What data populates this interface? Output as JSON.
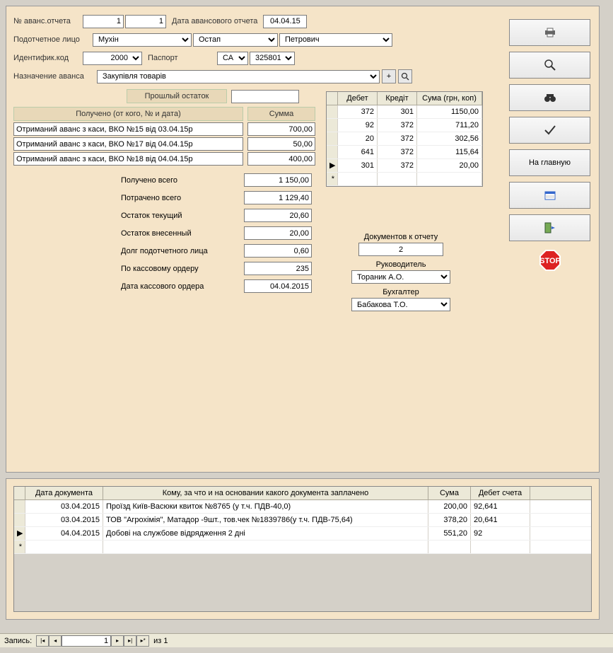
{
  "header": {
    "report_no_label": "№ аванс.отчета",
    "report_no1": "1",
    "report_no2": "1",
    "report_date_label": "Дата авансового отчета",
    "report_date": "04.04.15",
    "person_label": "Подотчетное лицо",
    "lastname": "Мухін",
    "firstname": "Остап",
    "patronymic": "Петрович",
    "id_label": "Идентифик.код",
    "id_code": "2000",
    "passport_label": "Паспорт",
    "passport_series": "СА",
    "passport_no": "325801",
    "purpose_label": "Назначение аванса",
    "purpose": "Закупівля товарів",
    "prev_balance_label": "Прошлый остаток",
    "prev_balance": ""
  },
  "received": {
    "header_who": "Получено (от кого, № и дата)",
    "header_sum": "Сумма",
    "rows": [
      {
        "desc": "Отриманий аванс з каси, ВКО №15 від 03.04.15р",
        "sum": "700,00"
      },
      {
        "desc": "Отриманий аванс з каси, ВКО №17 від 04.04.15р",
        "sum": "50,00"
      },
      {
        "desc": "Отриманий аванс з каси, ВКО №18 від 04.04.15р",
        "sum": "400,00"
      }
    ]
  },
  "summary": {
    "total_received_label": "Получено всего",
    "total_received": "1 150,00",
    "total_spent_label": "Потрачено всего",
    "total_spent": "1 129,40",
    "balance_current_label": "Остаток текущий",
    "balance_current": "20,60",
    "balance_deposited_label": "Остаток внесенный",
    "balance_deposited": "20,00",
    "debt_label": "Долг подотчетного лица",
    "debt": "0,60",
    "cash_order_label": "По кассовому ордеру",
    "cash_order": "235",
    "cash_order_date_label": "Дата кассового ордера",
    "cash_order_date": "04.04.2015"
  },
  "debit_grid": {
    "headers": [
      "Дебет",
      "Кредіт",
      "Сума (грн, коп)"
    ],
    "rows": [
      [
        "372",
        "301",
        "1150,00"
      ],
      [
        "92",
        "372",
        "711,20"
      ],
      [
        "20",
        "372",
        "302,56"
      ],
      [
        "641",
        "372",
        "115,64"
      ],
      [
        "301",
        "372",
        "20,00"
      ]
    ]
  },
  "docs": {
    "attached_label": "Документов к отчету",
    "attached": "2",
    "manager_label": "Руководитель",
    "manager": "Тораник А.О.",
    "accountant_label": "Бухгалтер",
    "accountant": "Бабакова Т.О."
  },
  "expense_grid": {
    "headers": [
      "Дата документа",
      "Кому, за что и на основании какого документа заплачено",
      "Сума",
      "Дебет счета"
    ],
    "rows": [
      [
        "03.04.2015",
        "Проїзд Київ-Васюки квиток №8765 (у т.ч. ПДВ-40,0)",
        "200,00",
        "92,641"
      ],
      [
        "03.04.2015",
        "ТОВ \"Агрохімія\", Матадор -9шт., тов.чек №1839786(у т.ч. ПДВ-75,64)",
        "378,20",
        "20,641"
      ],
      [
        "04.04.2015",
        "Добові на службове відрядження 2 дні",
        "551,20",
        "92"
      ]
    ]
  },
  "navbar": {
    "label": "Запись:",
    "pos": "1",
    "of_label": "из  1"
  },
  "buttons": {
    "home": "На главную",
    "stop": "STOP"
  }
}
